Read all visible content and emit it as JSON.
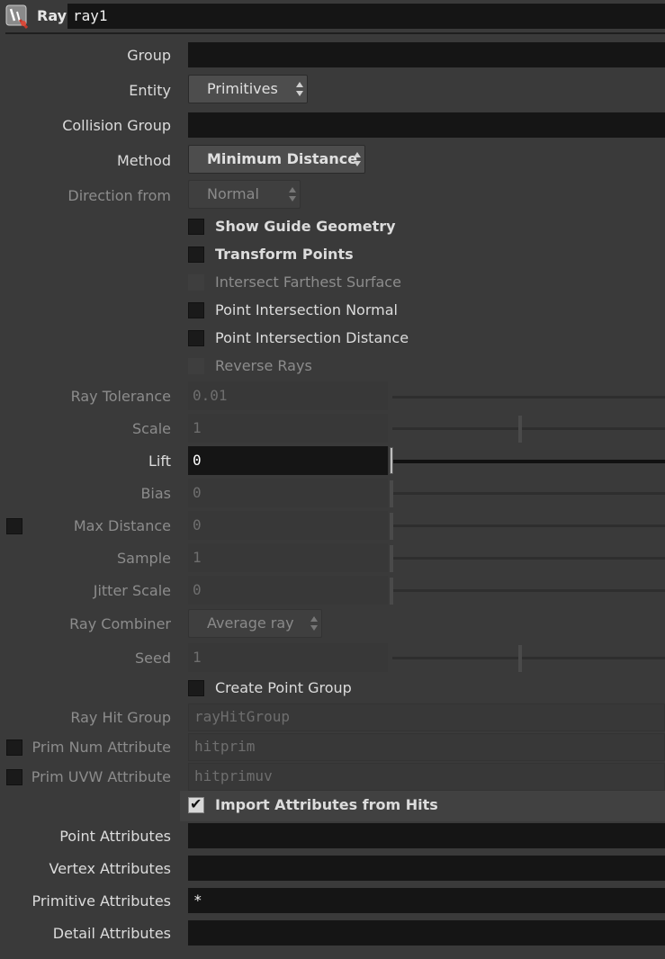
{
  "header": {
    "type_label": "Ray",
    "node_name": "ray1",
    "icon": "ray-node-icon"
  },
  "group": {
    "label": "Group",
    "value": ""
  },
  "entity": {
    "label": "Entity",
    "value": "Primitives"
  },
  "collision_group": {
    "label": "Collision Group",
    "value": ""
  },
  "method": {
    "label": "Method",
    "value": "Minimum Distance"
  },
  "direction_from": {
    "label": "Direction from",
    "value": "Normal"
  },
  "toggles": {
    "show_guide": "Show Guide Geometry",
    "transform_points": "Transform Points",
    "intersect_farthest": "Intersect Farthest Surface",
    "point_normal": "Point Intersection Normal",
    "point_distance": "Point Intersection Distance",
    "reverse_rays": "Reverse Rays"
  },
  "ray_tolerance": {
    "label": "Ray Tolerance",
    "value": "0.01"
  },
  "scale": {
    "label": "Scale",
    "value": "1"
  },
  "lift": {
    "label": "Lift",
    "value": "0"
  },
  "bias": {
    "label": "Bias",
    "value": "0"
  },
  "max_distance": {
    "label": "Max Distance",
    "value": "0"
  },
  "sample": {
    "label": "Sample",
    "value": "1"
  },
  "jitter_scale": {
    "label": "Jitter Scale",
    "value": "0"
  },
  "ray_combiner": {
    "label": "Ray Combiner",
    "value": "Average ray"
  },
  "seed": {
    "label": "Seed",
    "value": "1"
  },
  "create_point_group": {
    "label": "Create Point Group"
  },
  "ray_hit_group": {
    "label": "Ray Hit Group",
    "value": "rayHitGroup"
  },
  "prim_num_attr": {
    "label": "Prim Num Attribute",
    "value": "hitprim"
  },
  "prim_uvw_attr": {
    "label": "Prim UVW Attribute",
    "value": "hitprimuv"
  },
  "import_attrs": {
    "label": "Import Attributes from Hits",
    "checked_glyph": "✔"
  },
  "point_attrs": {
    "label": "Point Attributes",
    "value": ""
  },
  "vertex_attrs": {
    "label": "Vertex Attributes",
    "value": ""
  },
  "primitive_attrs": {
    "label": "Primitive Attributes",
    "value": "*"
  },
  "detail_attrs": {
    "label": "Detail Attributes",
    "value": ""
  }
}
